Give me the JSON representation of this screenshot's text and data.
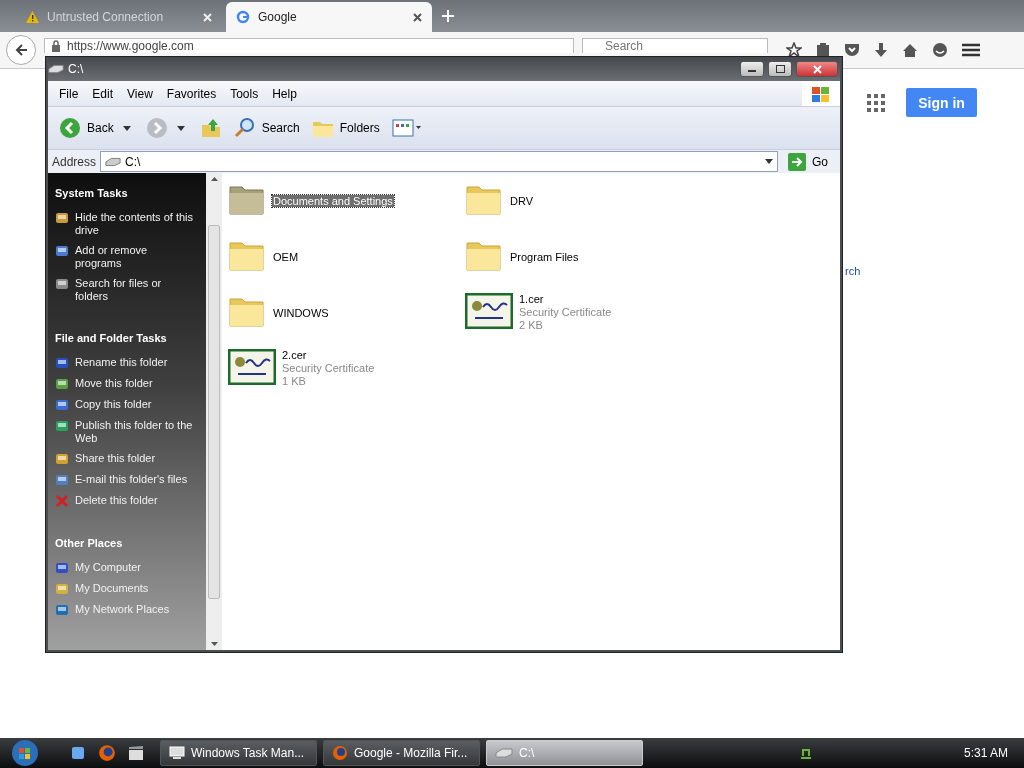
{
  "browser": {
    "tabs": [
      {
        "label": "Untrusted Connection",
        "kind": "warning",
        "selected": false
      },
      {
        "label": "Google",
        "kind": "google",
        "selected": true
      }
    ],
    "url": "https://www.google.com",
    "search": {
      "placeholder": "Search"
    },
    "page": {
      "sign_in": "Sign in",
      "link_fragment": "rch"
    }
  },
  "explorer": {
    "title": "C:\\",
    "menu": [
      "File",
      "Edit",
      "View",
      "Favorites",
      "Tools",
      "Help"
    ],
    "toolbar": [
      {
        "kind": "back",
        "label": "Back"
      },
      {
        "kind": "forward"
      },
      {
        "kind": "up"
      },
      {
        "kind": "search",
        "label": "Search"
      },
      {
        "kind": "folders",
        "label": "Folders"
      },
      {
        "kind": "views"
      }
    ],
    "address": {
      "label": "Address",
      "value": "C:\\",
      "go": "Go"
    },
    "sidebar": [
      {
        "title": "System Tasks",
        "items": [
          "Hide the contents of this drive",
          "Add or remove programs",
          "Search for files or folders"
        ]
      },
      {
        "title": "File and Folder Tasks",
        "items": [
          "Rename this folder",
          "Move this folder",
          "Copy this folder",
          "Publish this folder to the Web",
          "Share this folder",
          "E-mail this folder's files",
          "Delete this folder"
        ]
      },
      {
        "title": "Other Places",
        "items": [
          "My Computer",
          "My Documents",
          "My Network Places"
        ]
      }
    ],
    "files": [
      {
        "name": "Documents and Settings",
        "kind": "folder",
        "selected": true
      },
      {
        "name": "DRV",
        "kind": "folder",
        "selected": false
      },
      {
        "name": "OEM",
        "kind": "folder",
        "selected": false
      },
      {
        "name": "Program Files",
        "kind": "folder",
        "selected": false
      },
      {
        "name": "WINDOWS",
        "kind": "folder",
        "selected": false
      },
      {
        "name": "1.cer",
        "kind": "certificate",
        "type": "Security Certificate",
        "size": "2 KB",
        "selected": false
      },
      {
        "name": "2.cer",
        "kind": "certificate",
        "type": "Security Certificate",
        "size": "1 KB",
        "selected": false
      }
    ]
  },
  "taskbar": {
    "tasks": [
      {
        "label": "Windows Task Man...",
        "kind": "monitor",
        "selected": false
      },
      {
        "label": "Google - Mozilla Fir...",
        "kind": "firefox",
        "selected": false
      },
      {
        "label": "C:\\",
        "kind": "drive",
        "selected": true
      }
    ],
    "clock": "5:31 AM"
  }
}
